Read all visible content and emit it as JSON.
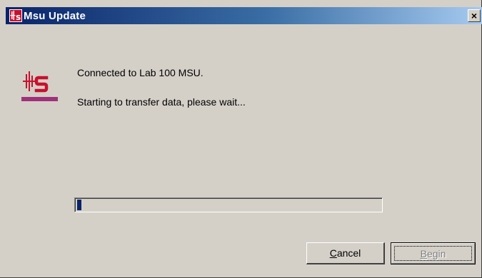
{
  "window": {
    "title": "Msu Update",
    "close_glyph": "×",
    "app_icon": "hs-logo-icon"
  },
  "content": {
    "logo": "hs-logo-icon",
    "message_line1": "Connected to Lab 100 MSU.",
    "message_line2": "Starting to transfer data, please wait...",
    "progress": 0.015
  },
  "buttons": {
    "cancel": {
      "accel": "C",
      "rest": "ancel",
      "enabled": true
    },
    "begin": {
      "accel": "B",
      "rest": "egin",
      "enabled": false
    }
  },
  "colors": {
    "title_gradient_start": "#0a246a",
    "title_gradient_end": "#a6caf0",
    "face": "#d4d0c8",
    "progress_fill": "#0a246a",
    "logo_red": "#c8102e",
    "logo_purple": "#a0307a"
  }
}
